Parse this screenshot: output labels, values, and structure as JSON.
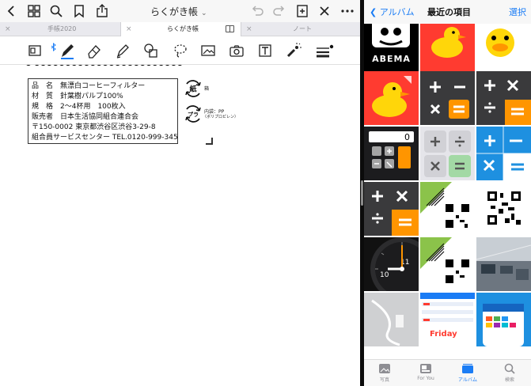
{
  "app": {
    "doc_title": "らくがき帳"
  },
  "tabs": [
    {
      "label": "手帳2020"
    },
    {
      "label": "らくがき帳"
    },
    {
      "label": "ノート"
    }
  ],
  "note_label": {
    "line1": "品　名　無漂白コーヒーフィルター",
    "line2": "材　質　針葉樹パルプ100%",
    "line3": "規　格　2～4杯用　100枚入",
    "line4": "販売者　日本生活協同組合連合会",
    "line5": "〒150-0002 東京都渋谷区渋谷3-29-8",
    "line6": "組合員サービスセンター TEL.0120-999-345",
    "recycle1_mark": "紙",
    "recycle1_label": "箱",
    "recycle2_mark": "プラ",
    "recycle2_label1": "内袋：PP",
    "recycle2_label2": "（ポリプロピレン）"
  },
  "photos": {
    "back_label": "アルバム",
    "title": "最近の項目",
    "select_label": "選択",
    "abema_text": "ABEMA",
    "calc_display": "0",
    "clock_numbers": [
      "11",
      "10"
    ],
    "friday_text": "Friday"
  },
  "bottom_tabs": [
    {
      "label": "写真"
    },
    {
      "label": "For You"
    },
    {
      "label": "アルバム"
    },
    {
      "label": "検索"
    }
  ],
  "colors": {
    "accent": "#1a7cf5",
    "duck_bg": "#ff3b30",
    "calc_orange": "#ff9500",
    "calc_blue": "#1e90e0"
  }
}
